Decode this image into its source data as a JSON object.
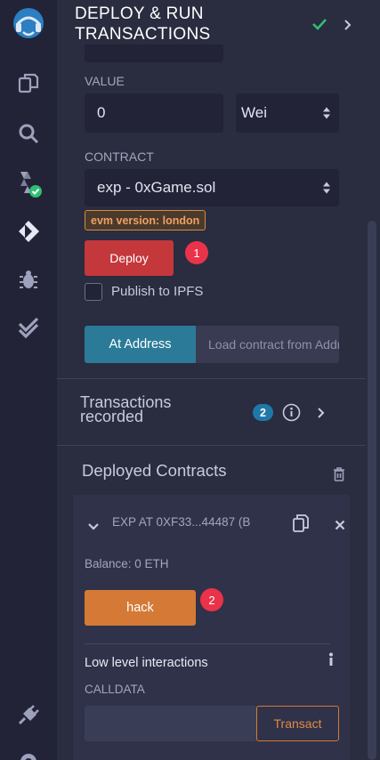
{
  "header": {
    "title_line1": "DEPLOY & RUN",
    "title_line2": "TRANSACTIONS",
    "status_icon": "check-icon",
    "accent_green": "#2fbf71"
  },
  "sidebar": {
    "items": [
      {
        "name": "remix-logo-icon"
      },
      {
        "name": "file-explorer-icon"
      },
      {
        "name": "search-icon"
      },
      {
        "name": "solidity-compiler-icon"
      },
      {
        "name": "deploy-run-icon"
      },
      {
        "name": "debugger-icon"
      },
      {
        "name": "testing-icon"
      },
      {
        "name": "plugin-manager-icon"
      },
      {
        "name": "settings-icon"
      }
    ]
  },
  "value": {
    "label": "VALUE",
    "amount": "0",
    "unit": "Wei"
  },
  "contract": {
    "label": "CONTRACT",
    "selected": "exp - 0xGame.sol",
    "evm_badge": "evm version: london"
  },
  "deploy": {
    "button_label": "Deploy",
    "marker": "1",
    "publish_label": "Publish to IPFS",
    "at_address_label": "At Address",
    "load_placeholder": "Load contract from Address"
  },
  "transactions": {
    "label_line1": "Transactions",
    "label_line2": "recorded",
    "count": "2"
  },
  "deployed": {
    "title": "Deployed Contracts",
    "instance_label": "EXP AT 0XF33...44487 (B",
    "balance": "Balance: 0 ETH",
    "hack_label": "hack",
    "marker": "2",
    "low_level_title": "Low level interactions",
    "calldata_label": "CALLDATA",
    "transact_label": "Transact"
  },
  "colors": {
    "deploy_red": "#c4373b",
    "at_address_blue": "#2b7b98",
    "hack_orange": "#d47a36",
    "badge_blue": "#1f78a8",
    "marker_red": "#e8334a"
  }
}
